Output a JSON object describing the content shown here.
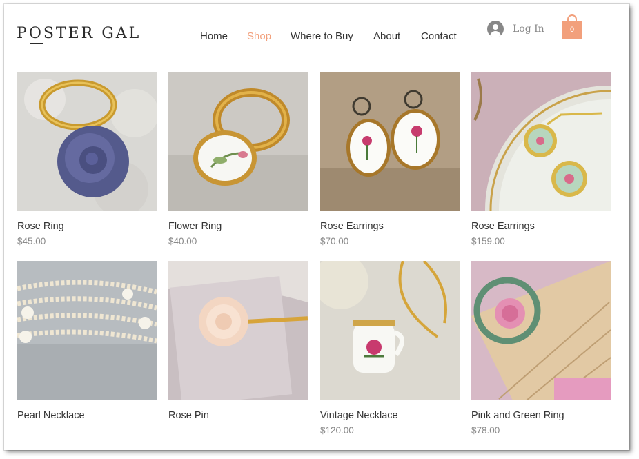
{
  "brand": {
    "logo_before": "P",
    "logo_o": "O",
    "logo_after": "STER GAL"
  },
  "nav": {
    "items": [
      {
        "label": "Home",
        "active": false
      },
      {
        "label": "Shop",
        "active": true
      },
      {
        "label": "Where to Buy",
        "active": false
      },
      {
        "label": "About",
        "active": false
      },
      {
        "label": "Contact",
        "active": false
      }
    ]
  },
  "account": {
    "login_label": "Log In",
    "icon": "user-avatar-icon"
  },
  "cart": {
    "count": "0",
    "icon": "shopping-bag-icon"
  },
  "colors": {
    "accent": "#f2a07c",
    "text": "#333333",
    "price": "#8a8a8a"
  },
  "products": [
    {
      "name": "Rose Ring",
      "price": "$45.00"
    },
    {
      "name": "Flower Ring",
      "price": "$40.00"
    },
    {
      "name": "Rose Earrings",
      "price": "$70.00"
    },
    {
      "name": "Rose Earrings",
      "price": "$159.00"
    },
    {
      "name": "Pearl Necklace",
      "price": ""
    },
    {
      "name": "Rose Pin",
      "price": ""
    },
    {
      "name": "Vintage Necklace",
      "price": "$120.00"
    },
    {
      "name": "Pink and Green Ring",
      "price": "$78.00"
    }
  ]
}
